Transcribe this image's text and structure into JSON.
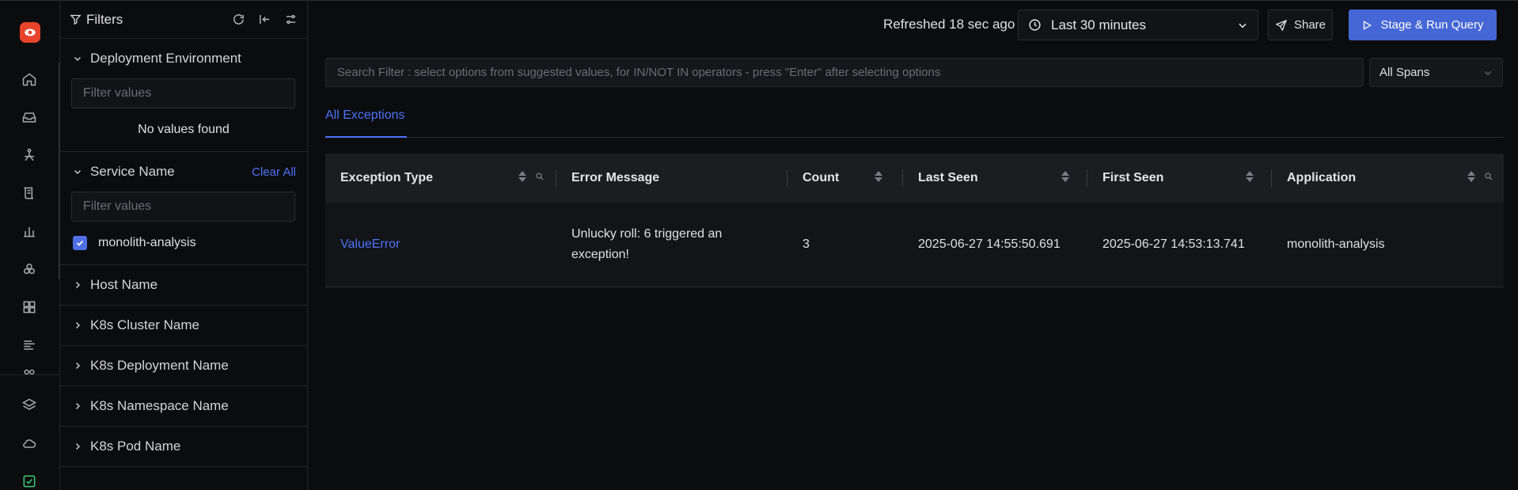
{
  "filters": {
    "title": "Filters",
    "sections": {
      "deployment_env": {
        "label": "Deployment Environment",
        "placeholder": "Filter values",
        "empty_text": "No values found"
      },
      "service_name": {
        "label": "Service Name",
        "clear_label": "Clear All",
        "placeholder": "Filter values",
        "selected_value": "monolith-analysis"
      },
      "host_name": {
        "label": "Host Name"
      },
      "k8s_cluster": {
        "label": "K8s Cluster Name"
      },
      "k8s_deployment": {
        "label": "K8s Deployment Name"
      },
      "k8s_namespace": {
        "label": "K8s Namespace Name"
      },
      "k8s_pod": {
        "label": "K8s Pod Name"
      }
    }
  },
  "topbar": {
    "refreshed": "Refreshed 18 sec ago",
    "time_range": "Last 30 minutes",
    "share_label": "Share",
    "run_label": "Stage & Run Query"
  },
  "search": {
    "placeholder": "Search Filter : select options from suggested values, for IN/NOT IN operators - press \"Enter\" after selecting options",
    "spans_option": "All Spans"
  },
  "tabs": [
    {
      "label": "All Exceptions",
      "active": true
    }
  ],
  "table": {
    "columns": [
      "Exception Type",
      "Error Message",
      "Count",
      "Last Seen",
      "First Seen",
      "Application"
    ],
    "rows": [
      {
        "exception_type": "ValueError",
        "error_message": "Unlucky roll: 6 triggered an exception!",
        "count": "3",
        "last_seen": "2025-06-27 14:55:50.691",
        "first_seen": "2025-06-27 14:53:13.741",
        "application": "monolith-analysis"
      }
    ]
  },
  "colors": {
    "accent": "#4e74f8",
    "primary_button": "#4566d6",
    "logo": "#e8432b",
    "background": "#0b0c0e"
  }
}
